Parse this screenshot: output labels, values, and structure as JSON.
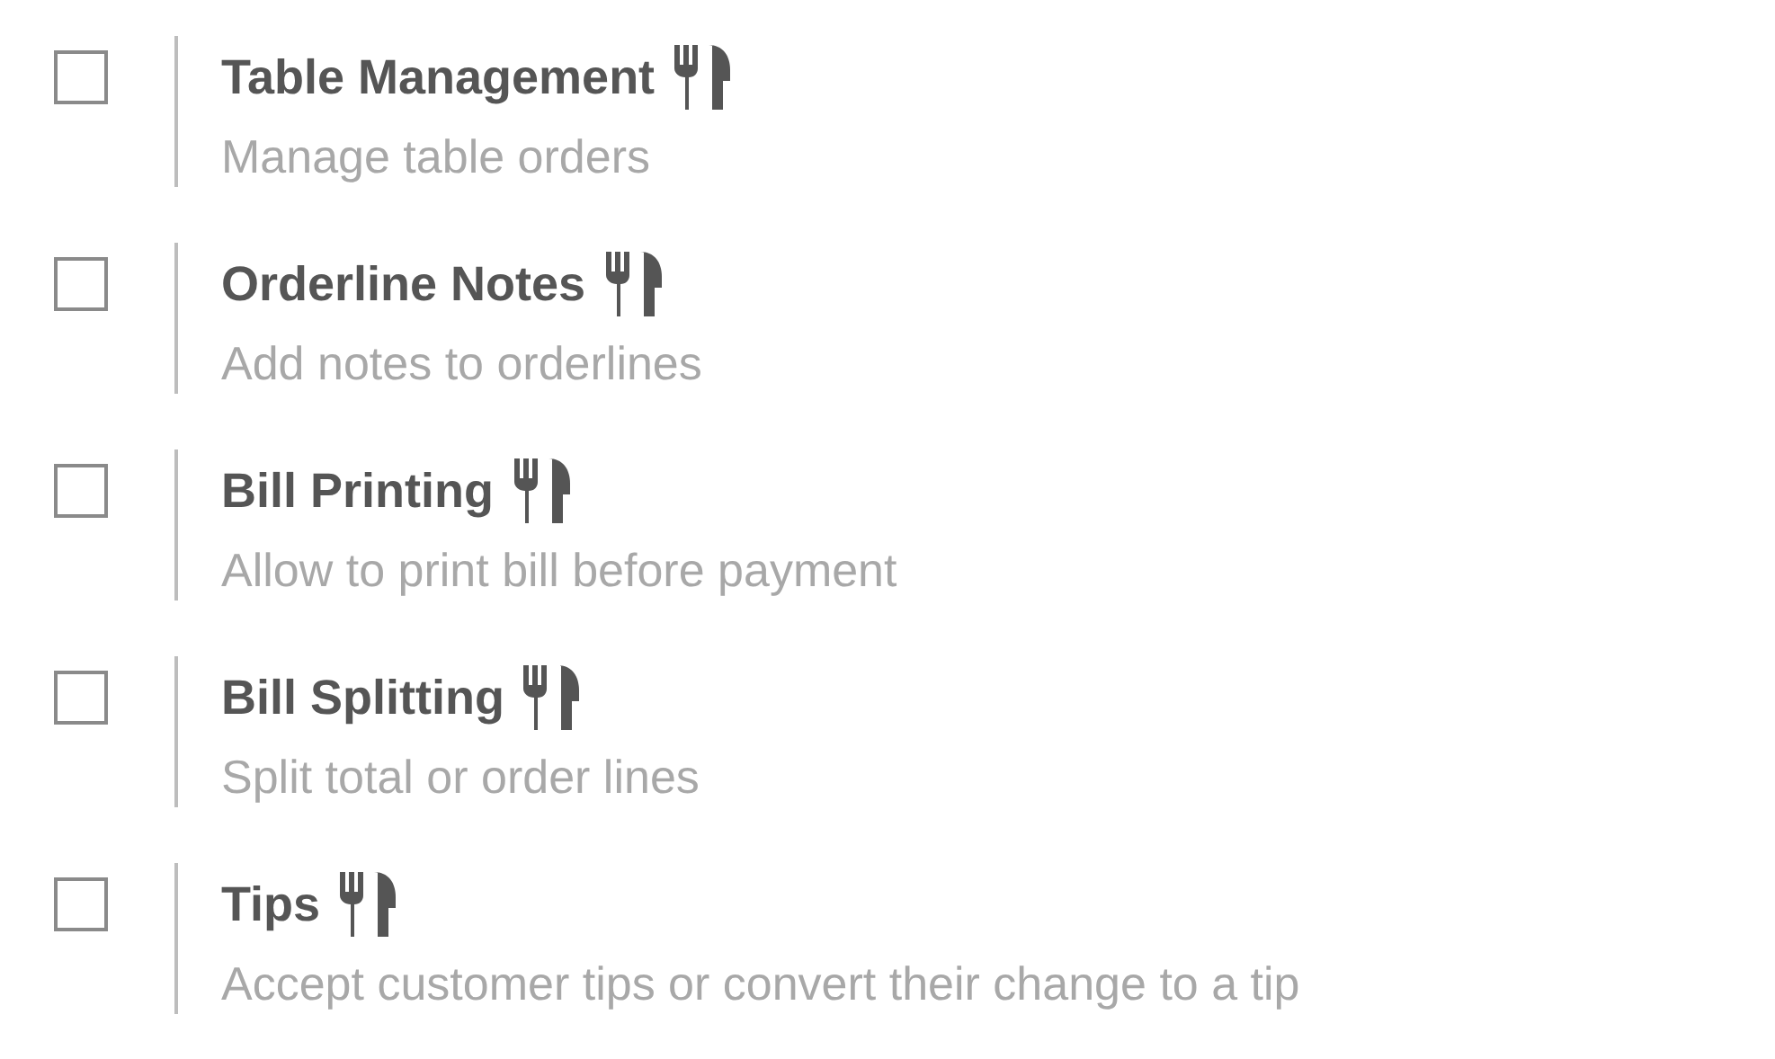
{
  "features": [
    {
      "title": "Table Management",
      "description": "Manage table orders",
      "checked": false
    },
    {
      "title": "Orderline Notes",
      "description": "Add notes to orderlines",
      "checked": false
    },
    {
      "title": "Bill Printing",
      "description": "Allow to print bill before payment",
      "checked": false
    },
    {
      "title": "Bill Splitting",
      "description": "Split total or order lines",
      "checked": false
    },
    {
      "title": "Tips",
      "description": "Accept customer tips or convert their change to a tip",
      "checked": false
    }
  ]
}
